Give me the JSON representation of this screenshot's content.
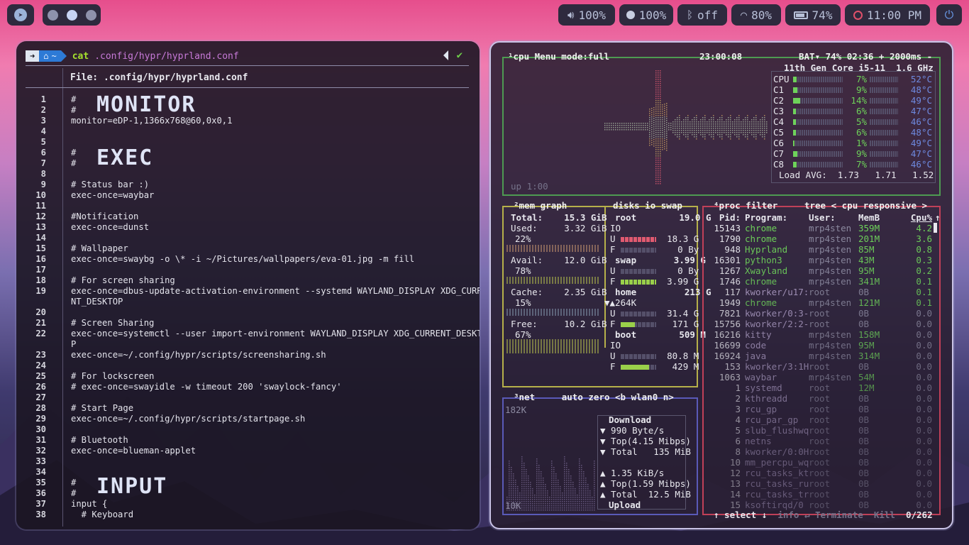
{
  "topbar": {
    "launcher_icon": "telegram-icon",
    "workspaces": 3,
    "volume": "100%",
    "brightness": "100%",
    "bluetooth": "off",
    "wifi": "80%",
    "battery": "74%",
    "clock": "11:00 PM",
    "power_icon": "power-icon"
  },
  "terminal": {
    "prompt_home": "~",
    "command": "cat",
    "argument": ".config/hypr/hyprland.conf",
    "file_label": "File: .config/hypr/hyprland.conf",
    "banner_monitor": "MONITOR",
    "banner_exec": "EXEC",
    "banner_input": "INPUT",
    "lines": [
      {
        "n": "1",
        "t": "#"
      },
      {
        "n": "2",
        "t": "#"
      },
      {
        "n": "3",
        "t": "monitor=eDP-1,1366x768@60,0x0,1"
      },
      {
        "n": "4",
        "t": ""
      },
      {
        "n": "5",
        "t": ""
      },
      {
        "n": "6",
        "t": "#"
      },
      {
        "n": "7",
        "t": "#"
      },
      {
        "n": "8",
        "t": ""
      },
      {
        "n": "9",
        "t": "# Status bar :)"
      },
      {
        "n": "10",
        "t": "exec-once=waybar"
      },
      {
        "n": "11",
        "t": ""
      },
      {
        "n": "12",
        "t": "#Notification"
      },
      {
        "n": "13",
        "t": "exec-once=dunst"
      },
      {
        "n": "14",
        "t": ""
      },
      {
        "n": "15",
        "t": "# Wallpaper"
      },
      {
        "n": "16",
        "t": "exec-once=swaybg -o \\* -i ~/Pictures/wallpapers/eva-01.jpg -m fill"
      },
      {
        "n": "17",
        "t": ""
      },
      {
        "n": "18",
        "t": "# For screen sharing"
      },
      {
        "n": "19",
        "t": "exec-once=dbus-update-activation-environment --systemd WAYLAND_DISPLAY XDG_CURRE"
      },
      {
        "n": "",
        "t": "NT_DESKTOP"
      },
      {
        "n": "20",
        "t": ""
      },
      {
        "n": "21",
        "t": "# Screen Sharing"
      },
      {
        "n": "22",
        "t": "exec-once=systemctl --user import-environment WAYLAND_DISPLAY XDG_CURRENT_DESKTO"
      },
      {
        "n": "",
        "t": "P"
      },
      {
        "n": "23",
        "t": "exec-once=~/.config/hypr/scripts/screensharing.sh"
      },
      {
        "n": "24",
        "t": ""
      },
      {
        "n": "25",
        "t": "# For lockscreen"
      },
      {
        "n": "26",
        "t": "# exec-once=swayidle -w timeout 200 'swaylock-fancy'"
      },
      {
        "n": "27",
        "t": ""
      },
      {
        "n": "28",
        "t": "# Start Page"
      },
      {
        "n": "29",
        "t": "exec-once=~/.config/hypr/scripts/startpage.sh"
      },
      {
        "n": "30",
        "t": ""
      },
      {
        "n": "31",
        "t": "# Bluetooth"
      },
      {
        "n": "32",
        "t": "exec-once=blueman-applet"
      },
      {
        "n": "33",
        "t": ""
      },
      {
        "n": "34",
        "t": ""
      },
      {
        "n": "35",
        "t": "#"
      },
      {
        "n": "36",
        "t": "#"
      },
      {
        "n": "37",
        "t": "input {"
      },
      {
        "n": "38",
        "t": "  # Keyboard"
      }
    ]
  },
  "btop": {
    "cpu": {
      "tab1": "¹cpu",
      "tab2": "Menu",
      "tab3": "mode:full",
      "time": "23:00:08",
      "bat": "BAT▾ 74% 02:36",
      "plus": "+",
      "interval": "2000ms",
      "minus": "-",
      "model": "11th Gen Core i5-11",
      "freq": "1.6 GHz",
      "uptime": "up 1:00",
      "rows": [
        {
          "name": "CPU",
          "pct": "7%",
          "temp": "52°C"
        },
        {
          "name": "C1",
          "pct": "9%",
          "temp": "48°C"
        },
        {
          "name": "C2",
          "pct": "14%",
          "temp": "49°C"
        },
        {
          "name": "C3",
          "pct": "6%",
          "temp": "47°C"
        },
        {
          "name": "C4",
          "pct": "5%",
          "temp": "46°C"
        },
        {
          "name": "C5",
          "pct": "6%",
          "temp": "48°C"
        },
        {
          "name": "C6",
          "pct": "1%",
          "temp": "49°C"
        },
        {
          "name": "C7",
          "pct": "9%",
          "temp": "47°C"
        },
        {
          "name": "C8",
          "pct": "7%",
          "temp": "46°C"
        }
      ],
      "load": "Load AVG:  1.73   1.71   1.52"
    },
    "mem": {
      "tab1": "²mem",
      "tab2": "graph",
      "total_l": "Total:",
      "total_v": "15.3 GiB",
      "used_l": "Used:",
      "used_v": "3.32 GiB",
      "used_p": "22%",
      "avail_l": "Avail:",
      "avail_v": "12.0 GiB",
      "avail_p": "78%",
      "cache_l": "Cache:",
      "cache_v": "2.35 GiB",
      "cache_p": "15%",
      "free_l": "Free:",
      "free_v": "10.2 GiB",
      "free_p": "67%"
    },
    "disks": {
      "tab1": "disks",
      "tab2": "io",
      "tab3": "swap",
      "root_l": "root",
      "root_v": "19.0 G",
      "io": "IO",
      "root_u": "18.3 G",
      "root_f": "0 By",
      "swap_l": "swap",
      "swap_v": "3.99 G",
      "swap_u": "0 By",
      "swap_f": "3.99 G",
      "home_l": "home",
      "home_v": "213 G",
      "home_io": "▼▲264K",
      "home_u": "31.4 G",
      "home_f": "171 G",
      "boot_l": "boot",
      "boot_v": "509 M",
      "boot_u": "80.8 M",
      "boot_f": "429 M",
      "u": "U",
      "f": "F"
    },
    "net": {
      "tab1": "³net",
      "tab2": "auto",
      "tab3": "zero",
      "iface": "<b wlan0 n>",
      "top_scale": "182K",
      "bot_scale": "10K",
      "download": "Download",
      "d_rate": "▼ 990 Byte/s",
      "d_top": "▼ Top(4.15 Mibps)",
      "d_total": "▼ Total   135 MiB",
      "u_rate": "▲ 1.35 KiB/s",
      "u_top": "▲ Top(1.59 Mibps)",
      "u_total": "▲ Total  12.5 MiB",
      "upload": "Upload"
    },
    "proc": {
      "tab1": "⁴proc",
      "tab2": "filter",
      "tab3": "tree",
      "mode": "< cpu responsive >",
      "h_pid": "Pid:",
      "h_prog": "Program:",
      "h_user": "User:",
      "h_mem": "MemB",
      "h_cpu": "Cpu%",
      "rows": [
        {
          "pid": "15143",
          "prog": "chrome",
          "user": "mrp4sten",
          "mem": "359M",
          "cpu": "4.2"
        },
        {
          "pid": "1790",
          "prog": "chrome",
          "user": "mrp4sten",
          "mem": "201M",
          "cpu": "3.6"
        },
        {
          "pid": "948",
          "prog": "Hyprland",
          "user": "mrp4sten",
          "mem": "85M",
          "cpu": "0.8"
        },
        {
          "pid": "16301",
          "prog": "python3",
          "user": "mrp4sten",
          "mem": "43M",
          "cpu": "0.3"
        },
        {
          "pid": "1267",
          "prog": "Xwayland",
          "user": "mrp4sten",
          "mem": "95M",
          "cpu": "0.2"
        },
        {
          "pid": "1746",
          "prog": "chrome",
          "user": "mrp4sten",
          "mem": "341M",
          "cpu": "0.1"
        },
        {
          "pid": "117",
          "prog": "kworker/u17:",
          "user": "root",
          "mem": "0B",
          "cpu": "0.1"
        },
        {
          "pid": "1949",
          "prog": "chrome",
          "user": "mrp4sten",
          "mem": "121M",
          "cpu": "0.1"
        },
        {
          "pid": "7821",
          "prog": "kworker/0:3-",
          "user": "root",
          "mem": "0B",
          "cpu": "0.0"
        },
        {
          "pid": "15756",
          "prog": "kworker/2:2-",
          "user": "root",
          "mem": "0B",
          "cpu": "0.0"
        },
        {
          "pid": "16216",
          "prog": "kitty",
          "user": "mrp4sten",
          "mem": "158M",
          "cpu": "0.0"
        },
        {
          "pid": "16699",
          "prog": "code",
          "user": "mrp4sten",
          "mem": "95M",
          "cpu": "0.0"
        },
        {
          "pid": "16924",
          "prog": "java",
          "user": "mrp4sten",
          "mem": "314M",
          "cpu": "0.0"
        },
        {
          "pid": "153",
          "prog": "kworker/3:1H",
          "user": "root",
          "mem": "0B",
          "cpu": "0.0"
        },
        {
          "pid": "1063",
          "prog": "waybar",
          "user": "mrp4sten",
          "mem": "54M",
          "cpu": "0.0"
        },
        {
          "pid": "1",
          "prog": "systemd",
          "user": "root",
          "mem": "12M",
          "cpu": "0.0"
        },
        {
          "pid": "2",
          "prog": "kthreadd",
          "user": "root",
          "mem": "0B",
          "cpu": "0.0"
        },
        {
          "pid": "3",
          "prog": "rcu_gp",
          "user": "root",
          "mem": "0B",
          "cpu": "0.0"
        },
        {
          "pid": "4",
          "prog": "rcu_par_gp",
          "user": "root",
          "mem": "0B",
          "cpu": "0.0"
        },
        {
          "pid": "5",
          "prog": "slub_flushwq",
          "user": "root",
          "mem": "0B",
          "cpu": "0.0"
        },
        {
          "pid": "6",
          "prog": "netns",
          "user": "root",
          "mem": "0B",
          "cpu": "0.0"
        },
        {
          "pid": "8",
          "prog": "kworker/0:0H",
          "user": "root",
          "mem": "0B",
          "cpu": "0.0"
        },
        {
          "pid": "10",
          "prog": "mm_percpu_wq",
          "user": "root",
          "mem": "0B",
          "cpu": "0.0"
        },
        {
          "pid": "12",
          "prog": "rcu_tasks_kt",
          "user": "root",
          "mem": "0B",
          "cpu": "0.0"
        },
        {
          "pid": "13",
          "prog": "rcu_tasks_ru",
          "user": "root",
          "mem": "0B",
          "cpu": "0.0"
        },
        {
          "pid": "14",
          "prog": "rcu_tasks_tr",
          "user": "root",
          "mem": "0B",
          "cpu": "0.0"
        },
        {
          "pid": "15",
          "prog": "ksoftirqd/0",
          "user": "root",
          "mem": "0B",
          "cpu": "0.0"
        }
      ],
      "f_select": "↑ select ↓",
      "f_info": "info ↵",
      "f_term": "Terminate",
      "f_kill": "Kill",
      "count": "0/262"
    }
  }
}
